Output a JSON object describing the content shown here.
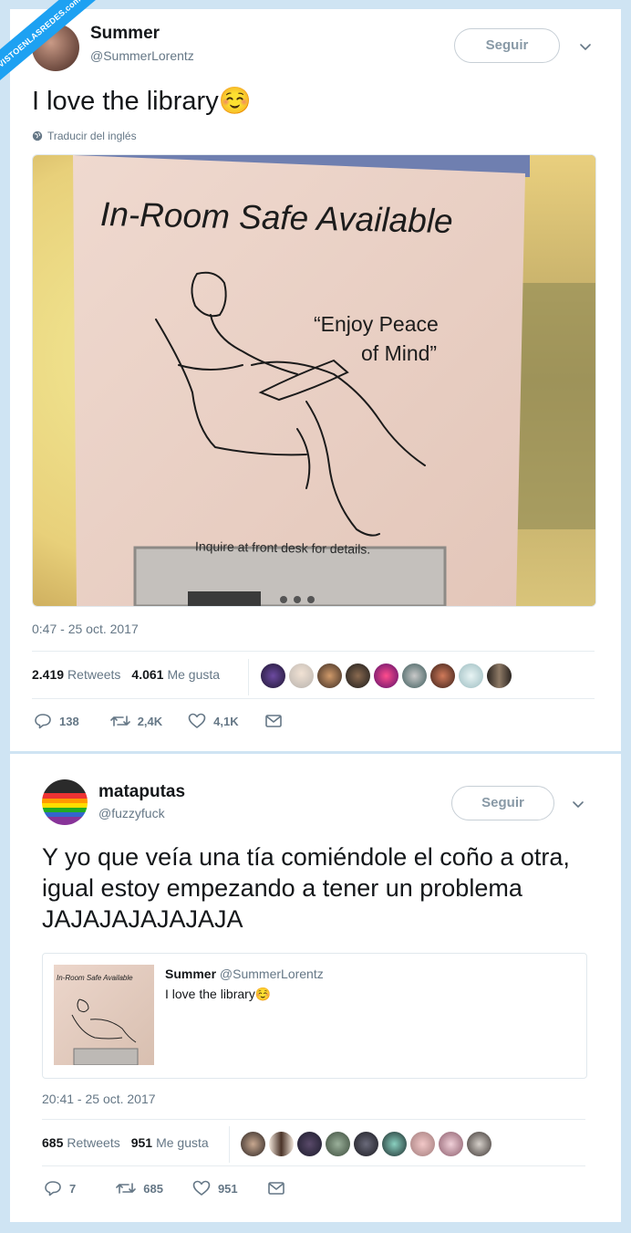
{
  "watermark": "VISTOENLASREDES.com",
  "tweet1": {
    "author_name": "Summer",
    "author_handle": "@SummerLorentz",
    "follow_label": "Seguir",
    "text": "I love the library☺️",
    "translate_label": "Traducir del inglés",
    "photo": {
      "headline": "In-Room Safe Available",
      "quote_line1": "“Enjoy Peace",
      "quote_line2": "of Mind”",
      "footer": "Inquire at front desk for details."
    },
    "timestamp": "0:47 - 25 oct. 2017",
    "retweets_count": "2.419",
    "retweets_label": "Retweets",
    "likes_count": "4.061",
    "likes_label": "Me gusta",
    "actions": {
      "replies": "138",
      "retweets": "2,4K",
      "likes": "4,1K"
    }
  },
  "tweet2": {
    "author_name": "mataputas",
    "author_handle": "@fuzzyfuck",
    "follow_label": "Seguir",
    "text": "Y yo que veía una tía comiéndole el coño a otra, igual estoy empezando a tener un problema JAJAJAJAJAJAJA",
    "quoted": {
      "author_name": "Summer",
      "author_handle": "@SummerLorentz",
      "text": "I love the library☺️",
      "thumb_headline": "In-Room Safe Available"
    },
    "timestamp": "20:41 - 25 oct. 2017",
    "retweets_count": "685",
    "retweets_label": "Retweets",
    "likes_count": "951",
    "likes_label": "Me gusta",
    "actions": {
      "replies": "7",
      "retweets": "685",
      "likes": "951"
    }
  },
  "colors": {
    "background": "#cfe4f3",
    "accent": "#1da1f2",
    "secondary_text": "#657786"
  }
}
